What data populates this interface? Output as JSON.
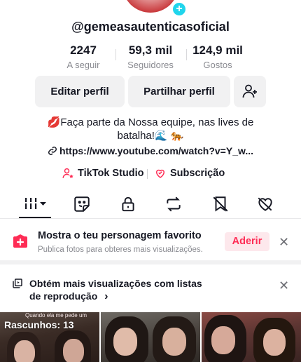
{
  "profile": {
    "username": "@gemeasautenticasoficial"
  },
  "stats": [
    {
      "value": "2247",
      "label": "A seguir"
    },
    {
      "value": "59,3 mil",
      "label": "Seguidores"
    },
    {
      "value": "124,9 mil",
      "label": "Gostos"
    }
  ],
  "actions": {
    "edit_label": "Editar perfil",
    "share_label": "Partilhar perfil"
  },
  "bio": {
    "line1": "💋Faça parte da Nossa equipe, nas lives de",
    "line2": "batalha!🌊 🐅",
    "link": "https://www.youtube.com/watch?v=Y_w..."
  },
  "links": {
    "studio": "TikTok Studio",
    "subscription": "Subscrição"
  },
  "tabs": [
    {
      "icon": "grid-icon",
      "active": true
    },
    {
      "icon": "sticker-icon"
    },
    {
      "icon": "lock-icon"
    },
    {
      "icon": "repost-icon"
    },
    {
      "icon": "bookmark-icon"
    },
    {
      "icon": "liked-icon"
    }
  ],
  "promo": {
    "title": "Mostra o teu personagem favorito",
    "subtitle": "Publica fotos para obteres mais visualizações.",
    "join_label": "Aderir"
  },
  "playlist": {
    "text": "Obtém mais visualizações com listas de reprodução",
    "chevron": "›"
  },
  "grid": {
    "drafts_label": "Rascunhos: 13",
    "caption": "Quando ela me pede um"
  },
  "colors": {
    "accent": "#fe2c55",
    "avatar_badge": "#20d5ec",
    "text": "#161823",
    "muted": "#8a8b91"
  }
}
